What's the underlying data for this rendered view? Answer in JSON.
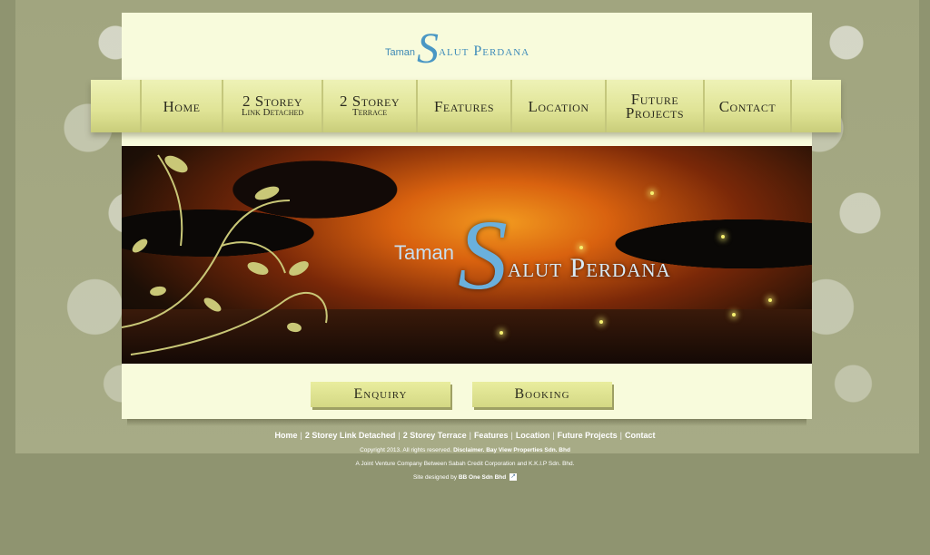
{
  "header": {
    "logo_small": "Taman",
    "logo_s": "S",
    "logo_rest": "alut Perdana"
  },
  "nav": {
    "items": [
      {
        "label": "Home"
      },
      {
        "label": "2 Storey",
        "sub": "Link Detached"
      },
      {
        "label": "2 Storey",
        "sub": "Terrace"
      },
      {
        "label": "Features"
      },
      {
        "label": "Location"
      },
      {
        "label": "Future",
        "sub": "Projects"
      },
      {
        "label": "Contact"
      }
    ]
  },
  "banner": {
    "logo_small": "Taman",
    "logo_s": "S",
    "logo_rest": "alut Perdana"
  },
  "actions": {
    "enquiry": "Enquiry",
    "booking": "Booking"
  },
  "footer": {
    "links": [
      "Home",
      "2 Storey Link Detached",
      "2 Storey Terrace",
      "Features",
      "Location",
      "Future Projects",
      "Contact"
    ],
    "separator": "|",
    "copyright": "Copyright 2013. All rights reserved.",
    "disclaimer": "Disclaimer.",
    "company": "Bay View Properties Sdn. Bhd",
    "joint_venture": "A Joint Venture Company Between Sabah Credit Corporation and K.K.I.P Sdn. Bhd.",
    "designed_by_label": "Site designed by",
    "designer": "BB One Sdn Bhd",
    "link_glyph": "↗"
  },
  "colors": {
    "page_background": "#8f9470",
    "container": "#f8fbdc",
    "nav_gradient_top": "#eef2b6",
    "logo_blue": "#4a97c4"
  }
}
